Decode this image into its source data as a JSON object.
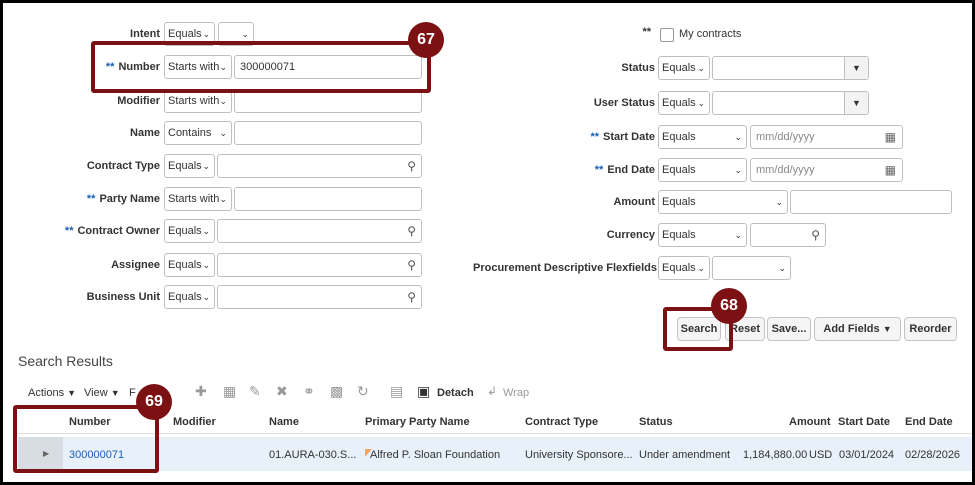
{
  "callouts": {
    "c67": "67",
    "c68": "68",
    "c69": "69"
  },
  "left_form": {
    "intent": {
      "label": "Intent",
      "operator": "Equals"
    },
    "number": {
      "label": "Number",
      "operator": "Starts with",
      "value": "300000071"
    },
    "modifier": {
      "label": "Modifier",
      "operator": "Starts with"
    },
    "name": {
      "label": "Name",
      "operator": "Contains"
    },
    "contract_type": {
      "label": "Contract Type",
      "operator": "Equals"
    },
    "party_name": {
      "label": "Party Name",
      "operator": "Starts with"
    },
    "contract_owner": {
      "label": "Contract Owner",
      "operator": "Equals"
    },
    "assignee": {
      "label": "Assignee",
      "operator": "Equals"
    },
    "business_unit": {
      "label": "Business Unit",
      "operator": "Equals"
    }
  },
  "right_form": {
    "my_contracts": {
      "label": "My contracts"
    },
    "status": {
      "label": "Status",
      "operator": "Equals"
    },
    "user_status": {
      "label": "User Status",
      "operator": "Equals"
    },
    "start_date": {
      "label": "Start Date",
      "operator": "Equals",
      "placeholder": "mm/dd/yyyy"
    },
    "end_date": {
      "label": "End Date",
      "operator": "Equals",
      "placeholder": "mm/dd/yyyy"
    },
    "amount": {
      "label": "Amount",
      "operator": "Equals"
    },
    "currency": {
      "label": "Currency",
      "operator": "Equals"
    },
    "flexfields": {
      "label": "Procurement Descriptive Flexfields",
      "operator": "Equals"
    }
  },
  "required_marker": "**",
  "buttons": {
    "search": "Search",
    "reset": "Reset",
    "save": "Save...",
    "add_fields": "Add Fields",
    "reorder": "Reorder"
  },
  "results": {
    "title": "Search Results",
    "toolbar": {
      "actions": "Actions",
      "view": "View",
      "format": "F",
      "detach": "Detach",
      "wrap": "Wrap"
    },
    "columns": [
      "Number",
      "Modifier",
      "Name",
      "Primary Party Name",
      "Contract Type",
      "Status",
      "Amount",
      "Start Date",
      "End Date"
    ],
    "rows": [
      {
        "number": "300000071",
        "modifier": "",
        "name": "01.AURA-030.S...",
        "party": "Alfred P. Sloan Foundation",
        "contract_type": "University Sponsore...",
        "status": "Under amendment",
        "amount": "1,184,880.00",
        "currency": "USD",
        "start_date": "03/01/2024",
        "end_date": "02/28/2026"
      }
    ]
  },
  "colors": {
    "callout": "#7b1113",
    "link": "#1a5fb4",
    "required": "#1a5fb4",
    "row_highlight": "#e8f0fa"
  }
}
